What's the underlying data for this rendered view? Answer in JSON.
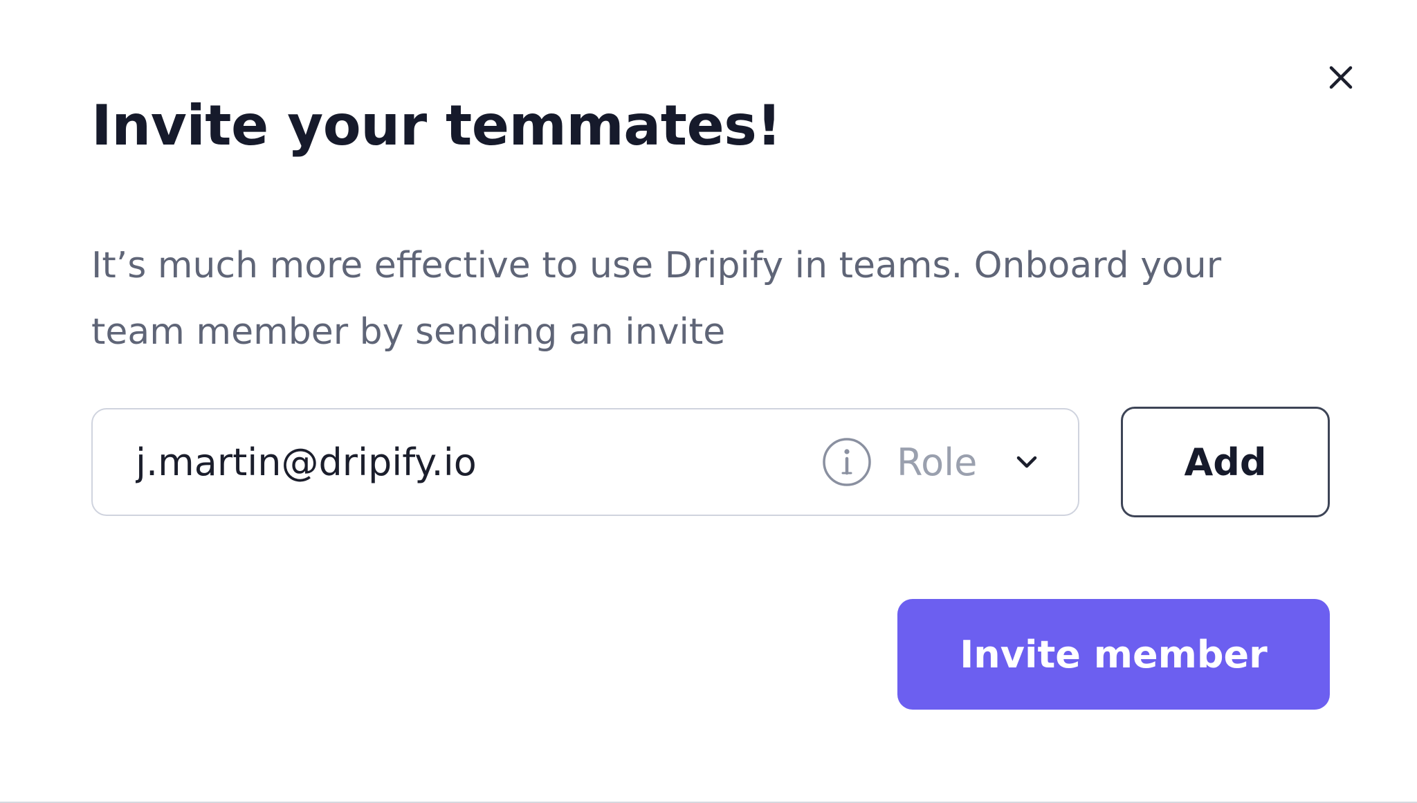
{
  "dialog": {
    "title": "Invite your temmates!",
    "description": "It’s much more effective to use Dripify in teams. Onboard your team member by sending an invite",
    "close_icon": "close-icon"
  },
  "invite_form": {
    "email_value": "j.martin@dripify.io",
    "info_icon": "info-icon",
    "role_placeholder": "Role",
    "role_chevron_icon": "chevron-down-icon",
    "add_label": "Add"
  },
  "actions": {
    "invite_label": "Invite member"
  },
  "colors": {
    "primary": "#6c5ff0",
    "title_text": "#161a2b",
    "body_text": "#5f6577",
    "placeholder_text": "#9aa0ae",
    "input_border": "#cfd3de"
  }
}
